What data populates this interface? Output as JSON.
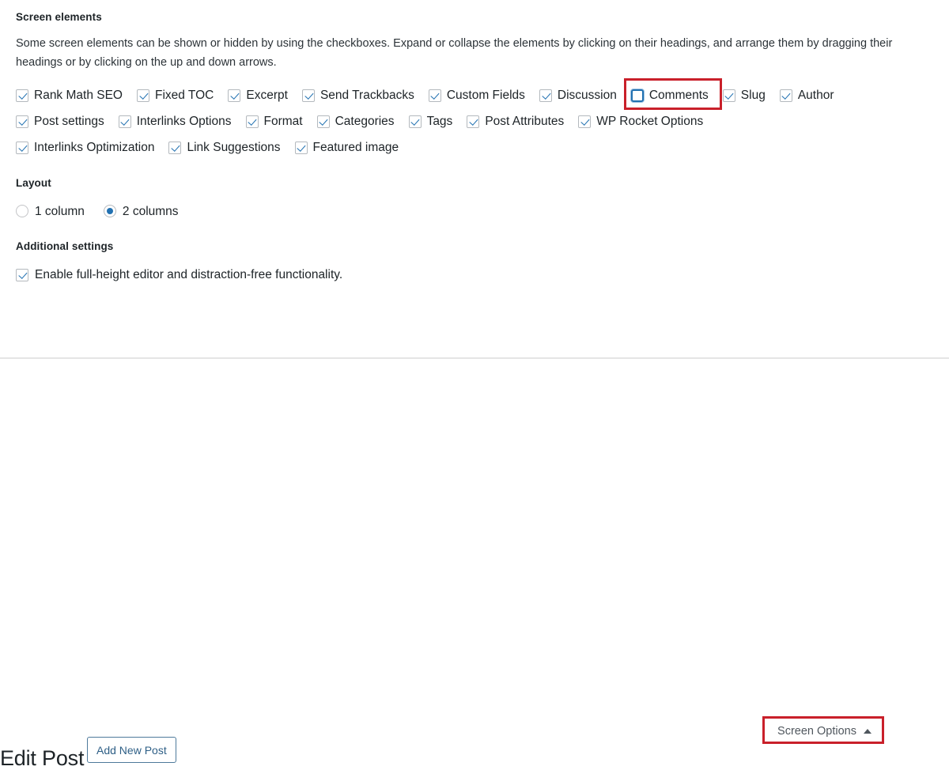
{
  "panel": {
    "section_title": "Screen elements",
    "description": "Some screen elements can be shown or hidden by using the checkboxes. Expand or collapse the elements by clicking on their headings, and arrange them by dragging their headings or by clicking on the up and down arrows.",
    "checkbox_rows": [
      [
        {
          "label": "Rank Math SEO",
          "checked": true
        },
        {
          "label": "Fixed TOC",
          "checked": true
        },
        {
          "label": "Excerpt",
          "checked": true
        },
        {
          "label": "Send Trackbacks",
          "checked": true
        },
        {
          "label": "Custom Fields",
          "checked": true
        },
        {
          "label": "Discussion",
          "checked": true
        },
        {
          "label": "Comments",
          "checked": false,
          "highlighted": true
        },
        {
          "label": "Slug",
          "checked": true
        },
        {
          "label": "Author",
          "checked": true
        }
      ],
      [
        {
          "label": "Post settings",
          "checked": true
        },
        {
          "label": "Interlinks Options",
          "checked": true
        },
        {
          "label": "Format",
          "checked": true
        },
        {
          "label": "Categories",
          "checked": true
        },
        {
          "label": "Tags",
          "checked": true
        },
        {
          "label": "Post Attributes",
          "checked": true
        },
        {
          "label": "WP Rocket Options",
          "checked": true
        }
      ],
      [
        {
          "label": "Interlinks Optimization",
          "checked": true
        },
        {
          "label": "Link Suggestions",
          "checked": true
        },
        {
          "label": "Featured image",
          "checked": true
        }
      ]
    ]
  },
  "layout": {
    "title": "Layout",
    "options": [
      {
        "label": "1 column",
        "selected": false
      },
      {
        "label": "2 columns",
        "selected": true
      }
    ]
  },
  "additional": {
    "title": "Additional settings",
    "option": {
      "label": "Enable full-height editor and distraction-free functionality.",
      "checked": true
    }
  },
  "footer": {
    "page_title": "Edit Post",
    "add_new_post_label": "Add New Post",
    "screen_options_label": "Screen Options",
    "screen_options_caret": "caret-up-icon"
  },
  "colors": {
    "accent_blue": "#2271b1",
    "annotation_red": "#c9202a",
    "text_primary": "#1d2327",
    "divider": "#e5e5e5",
    "checkbox_border": "#b4b9be"
  }
}
